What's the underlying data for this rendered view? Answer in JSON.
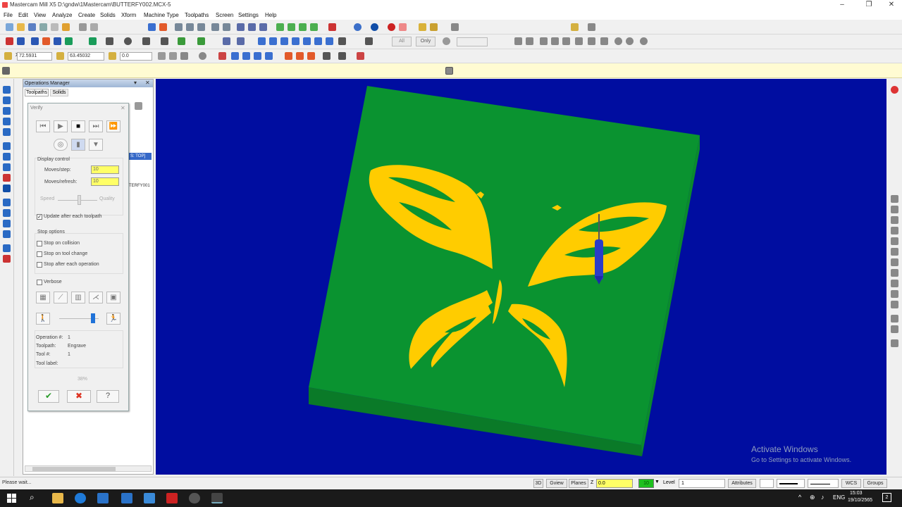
{
  "window": {
    "title": "Mastercam Mill X5 D:\\gndw\\1Mastercam\\BUTTERFY002.MCX-5",
    "min": "–",
    "max": "❐",
    "close": "✕"
  },
  "menu": [
    "File",
    "Edit",
    "View",
    "Analyze",
    "Create",
    "Solids",
    "Xform",
    "Machine Type",
    "Toolpaths",
    "Screen",
    "Settings",
    "Help"
  ],
  "coord_bar": {
    "x": "72.5931",
    "y": "63.45032",
    "z": "0.0"
  },
  "mask": {
    "all": "All",
    "only": "Only"
  },
  "ops_manager": {
    "title": "Operations Manager",
    "tabs": [
      "Toolpaths",
      "Solids"
    ],
    "tree_text_1": "S: TOP]",
    "tree_text_2": "TERFY001"
  },
  "verify": {
    "title": "Verify",
    "display_control": "Display control",
    "moves_step_label": "Moves/step:",
    "moves_step_value": "10",
    "moves_refresh_label": "Moves/refresh:",
    "moves_refresh_value": "10",
    "speed": "Speed",
    "quality": "Quality",
    "update_after": "Update after each toolpath",
    "stop_options": "Stop options",
    "stop_collision": "Stop on collision",
    "stop_tool_change": "Stop on tool change",
    "stop_after_op": "Stop after each operation",
    "verbose": "Verbose",
    "operation_no_label": "Operation #:",
    "operation_no": "1",
    "toolpath_label": "Toolpath:",
    "toolpath": "Engrave",
    "tool_no_label": "Tool #:",
    "tool_no": "1",
    "tool_label_label": "Tool label:",
    "progress": "38%"
  },
  "status": {
    "text": "Please wait...",
    "btn_3d": "3D",
    "gview": "Gview",
    "planes": "Planes",
    "z_label": "Z",
    "z_value": "0.0",
    "color_num": "10",
    "level_label": "Level",
    "level_value": "1",
    "attributes": "Attributes",
    "wcs": "WCS",
    "groups": "Groups"
  },
  "watermark": {
    "line1": "Activate Windows",
    "line2": "Go to Settings to activate Windows."
  },
  "taskbar": {
    "lang": "ENG",
    "time": "15:03",
    "date": "19/10/2565",
    "notif": "2"
  },
  "colors": {
    "viewport": "#000da0",
    "stock": "#0a9330",
    "engrave": "#ffcc00",
    "tool": "#2c3cc8"
  }
}
